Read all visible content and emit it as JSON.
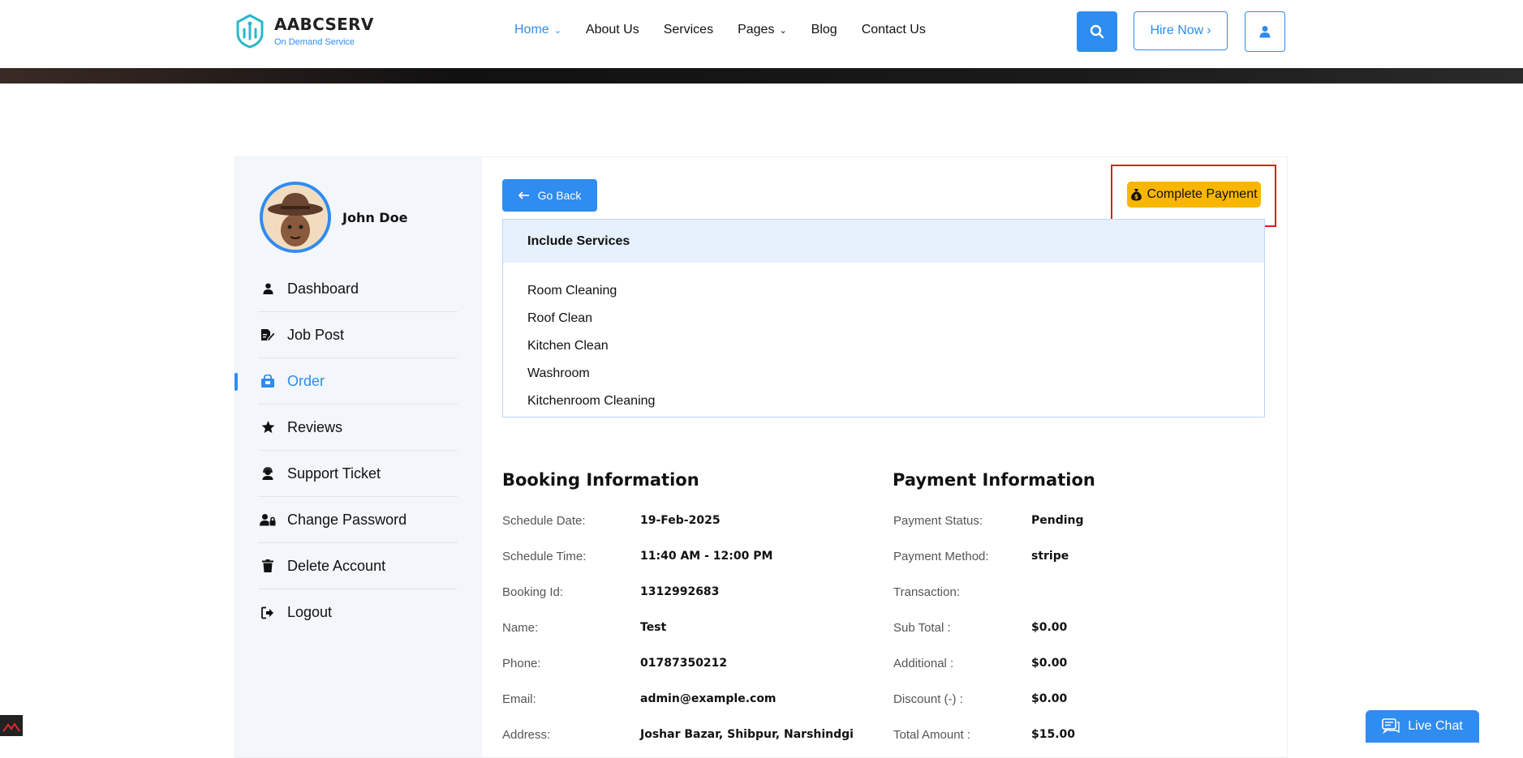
{
  "brand": {
    "name": "AABCSERV",
    "tagline": "On Demand Service"
  },
  "nav": [
    {
      "label": "Home",
      "dropdown": true,
      "active": true
    },
    {
      "label": "About Us"
    },
    {
      "label": "Services"
    },
    {
      "label": "Pages",
      "dropdown": true
    },
    {
      "label": "Blog"
    },
    {
      "label": "Contact Us"
    }
  ],
  "header": {
    "hire_label": "Hire Now"
  },
  "profile": {
    "name": "John Doe"
  },
  "sidebar": {
    "items": [
      {
        "label": "Dashboard",
        "icon": "user-icon"
      },
      {
        "label": "Job Post",
        "icon": "edit-file-icon"
      },
      {
        "label": "Order",
        "icon": "shopping-bag-icon",
        "active": true
      },
      {
        "label": "Reviews",
        "icon": "star-icon"
      },
      {
        "label": "Support Ticket",
        "icon": "headset-icon"
      },
      {
        "label": "Change Password",
        "icon": "user-lock-icon"
      },
      {
        "label": "Delete Account",
        "icon": "trash-icon"
      },
      {
        "label": "Logout",
        "icon": "logout-icon"
      }
    ]
  },
  "actions": {
    "go_back": "Go Back",
    "complete_payment": "Complete Payment"
  },
  "services": {
    "title": "Include Services",
    "items": [
      "Room Cleaning",
      "Roof Clean",
      "Kitchen Clean",
      "Washroom",
      "Kitchenroom Cleaning"
    ]
  },
  "booking": {
    "title": "Booking Information",
    "rows": [
      {
        "label": "Schedule Date:",
        "value": "19-Feb-2025"
      },
      {
        "label": "Schedule Time:",
        "value": "11:40 AM - 12:00 PM"
      },
      {
        "label": "Booking Id:",
        "value": "1312992683"
      },
      {
        "label": "Name:",
        "value": "Test"
      },
      {
        "label": "Phone:",
        "value": "01787350212"
      },
      {
        "label": "Email:",
        "value": "admin@example.com"
      },
      {
        "label": "Address:",
        "value": "Joshar Bazar, Shibpur, Narshindgi"
      }
    ]
  },
  "payment": {
    "title": "Payment Information",
    "rows": [
      {
        "label": "Payment Status:",
        "value": "Pending"
      },
      {
        "label": "Payment Method:",
        "value": "stripe"
      },
      {
        "label": "Transaction:",
        "value": ""
      },
      {
        "label": "Sub Total :",
        "value": "$0.00"
      },
      {
        "label": "Additional :",
        "value": "$0.00"
      },
      {
        "label": "Discount (-) :",
        "value": "$0.00"
      },
      {
        "label": "Total Amount :",
        "value": "$15.00"
      }
    ]
  },
  "live_chat": {
    "label": "Live Chat"
  },
  "colors": {
    "primary": "#2f8cf0",
    "payment": "#f8b600",
    "highlight": "#e01b1b"
  }
}
